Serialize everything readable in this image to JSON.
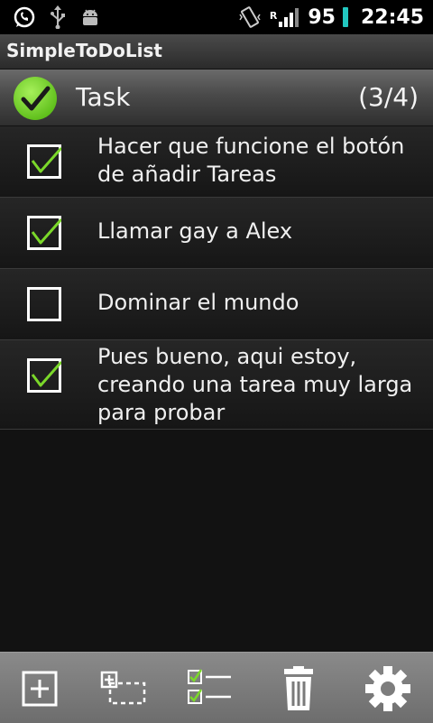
{
  "status_bar": {
    "icons": [
      "whatsapp-icon",
      "usb-icon",
      "android-debug-icon",
      "vibrate-icon",
      "roaming-icon",
      "signal-icon",
      "battery-icon"
    ],
    "roaming_badge": "R",
    "battery_percent": "95",
    "time": "22:45"
  },
  "app": {
    "title": "SimpleToDoList"
  },
  "header": {
    "label": "Task",
    "count": "(3/4)"
  },
  "tasks": [
    {
      "text": "Hacer que funcione el botón de añadir Tareas",
      "checked": true
    },
    {
      "text": "Llamar gay a Alex",
      "checked": true
    },
    {
      "text": "Dominar el mundo",
      "checked": false
    },
    {
      "text": "Pues bueno, aqui estoy, creando una tarea muy larga para probar",
      "checked": true
    }
  ],
  "toolbar": {
    "buttons": [
      "add-task-icon",
      "add-subtask-icon",
      "check-list-icon",
      "trash-icon",
      "settings-gear-icon"
    ]
  },
  "colors": {
    "accent_green": "#7bd82a",
    "battery": "#22c7c0"
  }
}
